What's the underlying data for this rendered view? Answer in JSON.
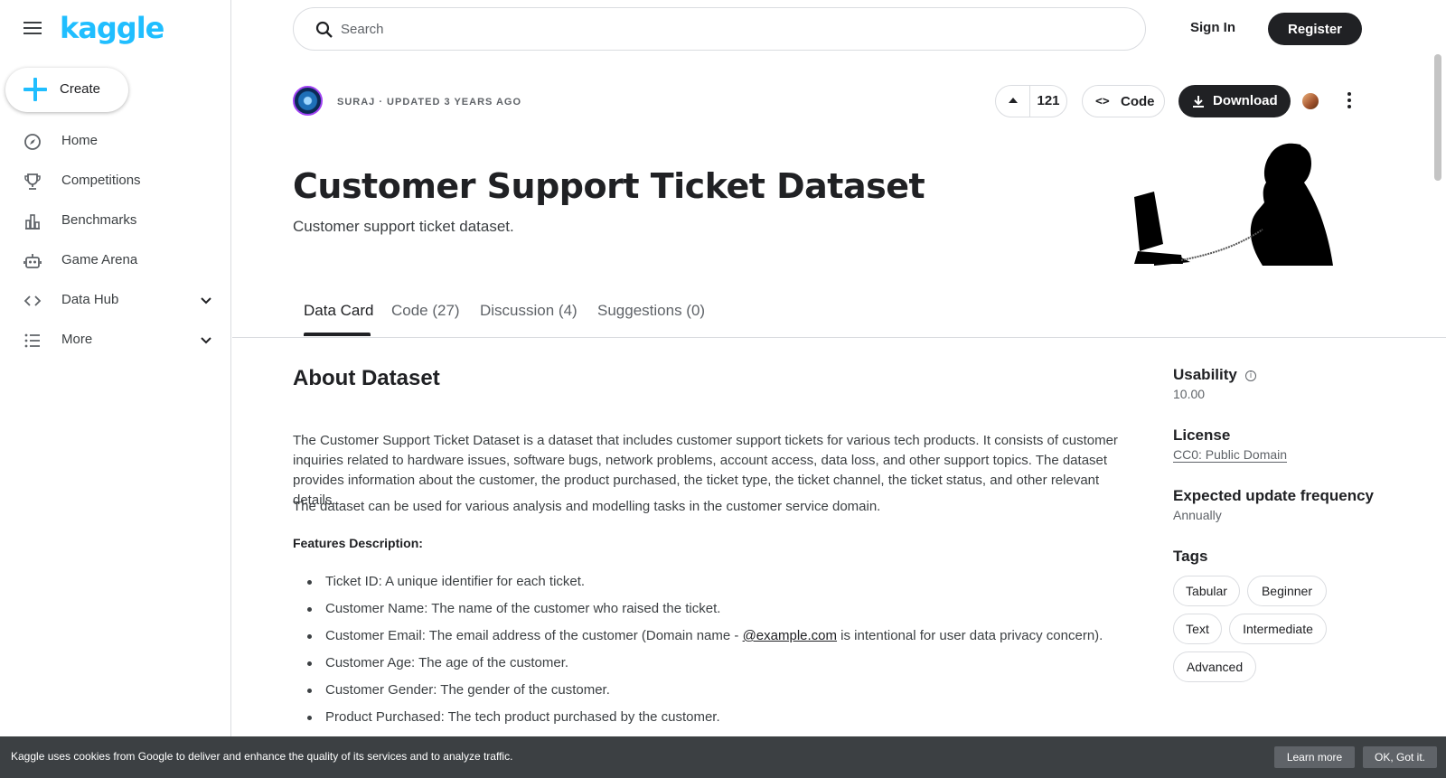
{
  "sidebar": {
    "logo": "kaggle",
    "create_label": "Create",
    "items": [
      {
        "label": "Home",
        "icon": "compass-icon"
      },
      {
        "label": "Competitions",
        "icon": "trophy-icon"
      },
      {
        "label": "Benchmarks",
        "icon": "bar-chart-icon"
      },
      {
        "label": "Game Arena",
        "icon": "robot-icon"
      },
      {
        "label": "Data Hub",
        "icon": "code-icon",
        "expandable": true
      },
      {
        "label": "More",
        "icon": "list-icon",
        "expandable": true
      }
    ]
  },
  "header": {
    "search_placeholder": "Search",
    "signin_label": "Sign In",
    "register_label": "Register"
  },
  "dataset": {
    "owner_line": "SURAJ · UPDATED 3 YEARS AGO",
    "upvotes": "121",
    "code_label": "Code",
    "download_label": "Download",
    "title": "Customer Support Ticket Dataset",
    "subtitle": "Customer support ticket dataset."
  },
  "tabs": [
    {
      "label": "Data Card",
      "active": true
    },
    {
      "label": "Code (27)"
    },
    {
      "label": "Discussion (4)"
    },
    {
      "label": "Suggestions (0)"
    }
  ],
  "about": {
    "heading": "About Dataset",
    "paragraph1": "The Customer Support Ticket Dataset is a dataset that includes customer support tickets for various tech products. It consists of customer inquiries related to hardware issues, software bugs, network problems, account access, data loss, and other support topics. The dataset provides information about the customer, the product purchased, the ticket type, the ticket channel, the ticket status, and other relevant details.",
    "paragraph2": "The dataset can be used for various analysis and modelling tasks in the customer service domain.",
    "features_heading": "Features Description:",
    "bullets": [
      "Ticket ID: A unique identifier for each ticket.",
      "Customer Name: The name of the customer who raised the ticket.",
      "Customer Email: The email address of the customer (Domain name - ",
      "Customer Age: The age of the customer.",
      "Customer Gender: The gender of the customer.",
      "Product Purchased: The tech product purchased by the customer."
    ],
    "email_link": "@example.com",
    "email_suffix": " is intentional for user data privacy concern)."
  },
  "side": {
    "usability_label": "Usability",
    "usability_value": "10.00",
    "license_label": "License",
    "license_value": "CC0: Public Domain",
    "frequency_label": "Expected update frequency",
    "frequency_value": "Annually",
    "tags_label": "Tags",
    "tags": [
      "Tabular",
      "Beginner",
      "Text",
      "Intermediate",
      "Advanced"
    ]
  },
  "cookie": {
    "text": "Kaggle uses cookies from Google to deliver and enhance the quality of its services and to analyze traffic.",
    "learn_more": "Learn more",
    "ok": "OK, Got it."
  },
  "colors": {
    "brand": "#20beff",
    "dark": "#202124",
    "border": "#dadce0"
  }
}
